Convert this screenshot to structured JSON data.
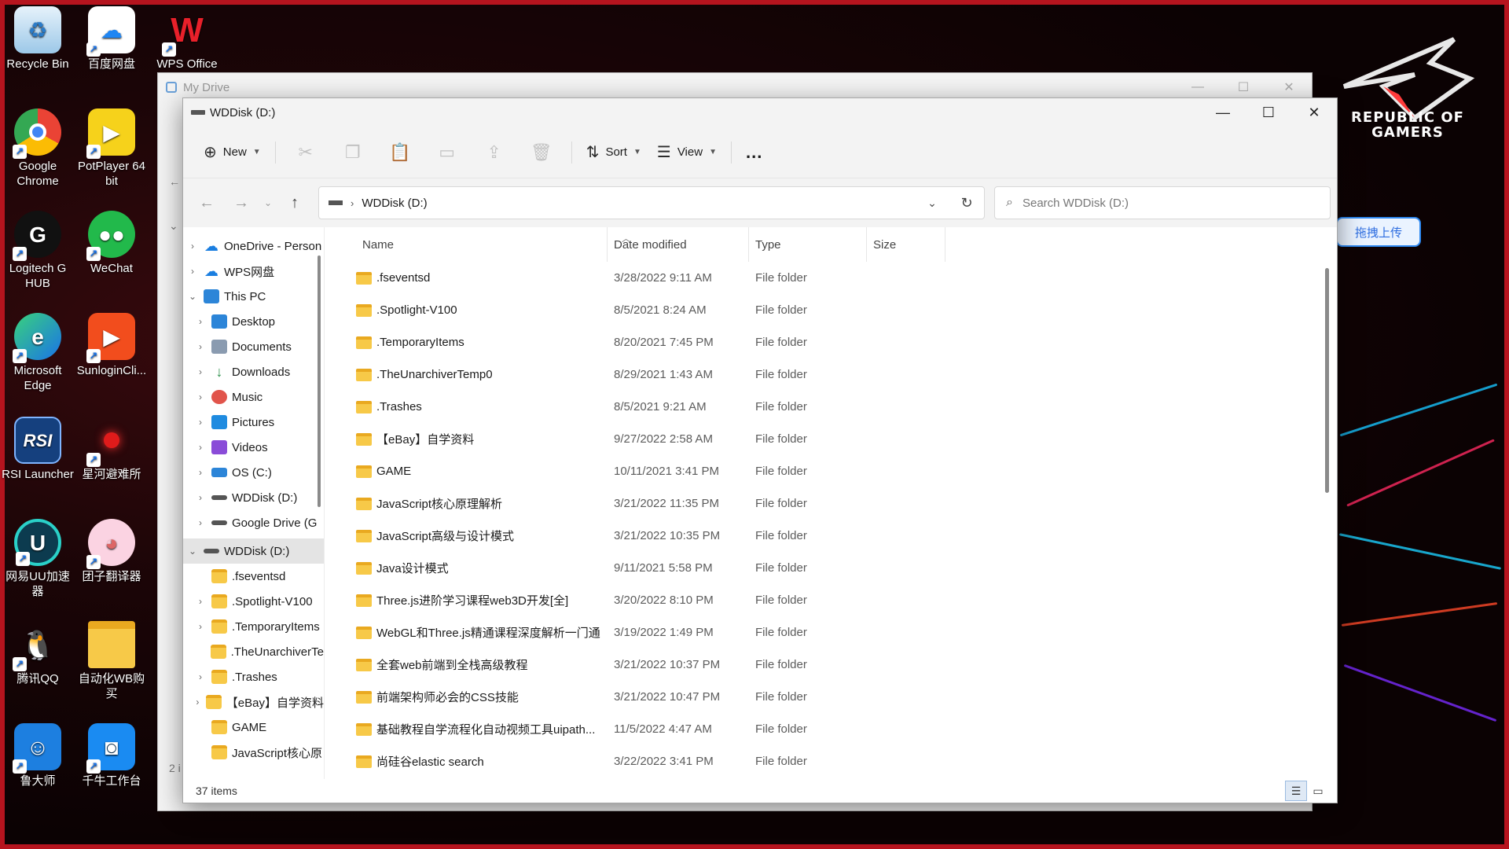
{
  "desktop": {
    "icons": [
      {
        "label": "Recycle Bin",
        "icon": "recycle-bin-icon"
      },
      {
        "label": "百度网盘",
        "icon": "baidu-netdisk-icon"
      },
      {
        "label": "WPS Office",
        "icon": "wps-office-icon"
      },
      {
        "label": "Google Chrome",
        "icon": "chrome-icon"
      },
      {
        "label": "PotPlayer 64 bit",
        "icon": "potplayer-icon"
      },
      {
        "label": "Logitech G HUB",
        "icon": "logitech-icon"
      },
      {
        "label": "WeChat",
        "icon": "wechat-icon"
      },
      {
        "label": "Microsoft Edge",
        "icon": "edge-icon"
      },
      {
        "label": "SunloginCli...",
        "icon": "sunlogin-icon"
      },
      {
        "label": "RSI Launcher",
        "icon": "rsi-icon"
      },
      {
        "label": "星河避难所",
        "icon": "star-haven-icon"
      },
      {
        "label": "网易UU加速器",
        "icon": "uu-accelerator-icon"
      },
      {
        "label": "团子翻译器",
        "icon": "tuanzi-translator-icon"
      },
      {
        "label": "腾讯QQ",
        "icon": "qq-icon"
      },
      {
        "label": "自动化WB购买",
        "icon": "folder-icon"
      },
      {
        "label": "鲁大师",
        "icon": "ludashi-icon"
      },
      {
        "label": "千牛工作台",
        "icon": "qianniu-icon"
      }
    ],
    "brand_line1": "REPUBLIC OF",
    "brand_line2": "GAMERS",
    "baidu_float": "拖拽上传"
  },
  "bg_window": {
    "title": "My Drive",
    "ghost_text": "2 i"
  },
  "window": {
    "title": "WDDisk (D:)",
    "toolbar": {
      "new_label": "New",
      "sort_label": "Sort",
      "view_label": "View",
      "more_label": "..."
    },
    "address": {
      "path": "WDDisk (D:)",
      "search_placeholder": "Search WDDisk (D:)"
    },
    "nav": {
      "items": [
        {
          "label": "OneDrive - Person",
          "icon": "onedrive-icon"
        },
        {
          "label": "WPS网盘",
          "icon": "wps-cloud-icon"
        },
        {
          "label": "This PC",
          "icon": "this-pc-icon"
        },
        {
          "label": "Desktop",
          "icon": "desktop-folder-icon"
        },
        {
          "label": "Documents",
          "icon": "documents-icon"
        },
        {
          "label": "Downloads",
          "icon": "downloads-icon"
        },
        {
          "label": "Music",
          "icon": "music-icon"
        },
        {
          "label": "Pictures",
          "icon": "pictures-icon"
        },
        {
          "label": "Videos",
          "icon": "videos-icon"
        },
        {
          "label": "OS (C:)",
          "icon": "os-drive-icon"
        },
        {
          "label": "WDDisk (D:)",
          "icon": "drive-icon"
        },
        {
          "label": "Google Drive (G",
          "icon": "drive-icon"
        },
        {
          "label": "WDDisk (D:)",
          "icon": "drive-icon"
        },
        {
          "label": ".fseventsd",
          "icon": "folder-icon"
        },
        {
          "label": ".Spotlight-V100",
          "icon": "folder-icon"
        },
        {
          "label": ".TemporaryItems",
          "icon": "folder-icon"
        },
        {
          "label": ".TheUnarchiverTe",
          "icon": "folder-icon"
        },
        {
          "label": ".Trashes",
          "icon": "folder-icon"
        },
        {
          "label": "【eBay】自学资料",
          "icon": "folder-icon"
        },
        {
          "label": "GAME",
          "icon": "folder-icon"
        },
        {
          "label": "JavaScript核心原",
          "icon": "folder-icon"
        }
      ]
    },
    "columns": {
      "name": "Name",
      "date": "Date modified",
      "type": "Type",
      "size": "Size"
    },
    "files": [
      {
        "name": ".fseventsd",
        "date": "3/28/2022 9:11 AM",
        "type": "File folder"
      },
      {
        "name": ".Spotlight-V100",
        "date": "8/5/2021 8:24 AM",
        "type": "File folder"
      },
      {
        "name": ".TemporaryItems",
        "date": "8/20/2021 7:45 PM",
        "type": "File folder"
      },
      {
        "name": ".TheUnarchiverTemp0",
        "date": "8/29/2021 1:43 AM",
        "type": "File folder"
      },
      {
        "name": ".Trashes",
        "date": "8/5/2021 9:21 AM",
        "type": "File folder"
      },
      {
        "name": "【eBay】自学资料",
        "date": "9/27/2022 2:58 AM",
        "type": "File folder"
      },
      {
        "name": "GAME",
        "date": "10/11/2021 3:41 PM",
        "type": "File folder"
      },
      {
        "name": "JavaScript核心原理解析",
        "date": "3/21/2022 11:35 PM",
        "type": "File folder"
      },
      {
        "name": "JavaScript高级与设计模式",
        "date": "3/21/2022 10:35 PM",
        "type": "File folder"
      },
      {
        "name": "Java设计模式",
        "date": "9/11/2021 5:58 PM",
        "type": "File folder"
      },
      {
        "name": "Three.js进阶学习课程web3D开发[全]",
        "date": "3/20/2022 8:10 PM",
        "type": "File folder"
      },
      {
        "name": "WebGL和Three.js精通课程深度解析一门通",
        "date": "3/19/2022 1:49 PM",
        "type": "File folder"
      },
      {
        "name": "全套web前端到全栈高级教程",
        "date": "3/21/2022 10:37 PM",
        "type": "File folder"
      },
      {
        "name": "前端架构师必会的CSS技能",
        "date": "3/21/2022 10:47 PM",
        "type": "File folder"
      },
      {
        "name": "基础教程自学流程化自动视频工具uipath...",
        "date": "11/5/2022 4:47 AM",
        "type": "File folder"
      },
      {
        "name": "尚硅谷elastic search",
        "date": "3/22/2022 3:41 PM",
        "type": "File folder"
      }
    ],
    "status": {
      "count": "37 items"
    }
  }
}
